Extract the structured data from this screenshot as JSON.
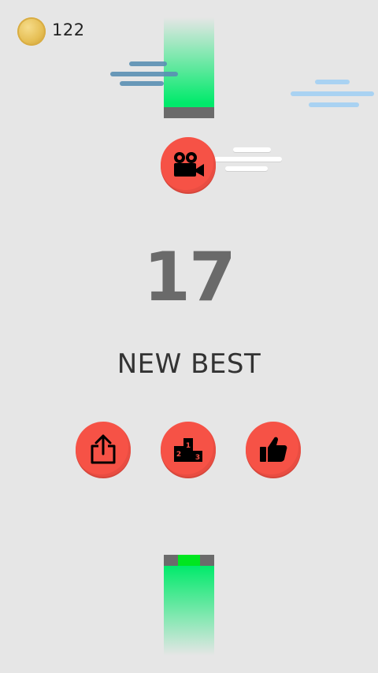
{
  "hud": {
    "coins": "122"
  },
  "result": {
    "score": "17",
    "best_label": "NEW BEST"
  },
  "buttons": {
    "video": "video-camera-icon",
    "share": "share-icon",
    "leaderboard": "podium-icon",
    "rate": "thumbs-up-icon"
  },
  "podium_numbers": [
    "2",
    "1",
    "3"
  ],
  "colors": {
    "background": "#e6e6e6",
    "button_red": "#f65246",
    "pillar_green": "#00ea6b",
    "target_green": "#00e620",
    "pillar_cap": "#6b6b6b",
    "score_gray": "#6a6a6a",
    "coin_gold": "#e6bf55"
  }
}
